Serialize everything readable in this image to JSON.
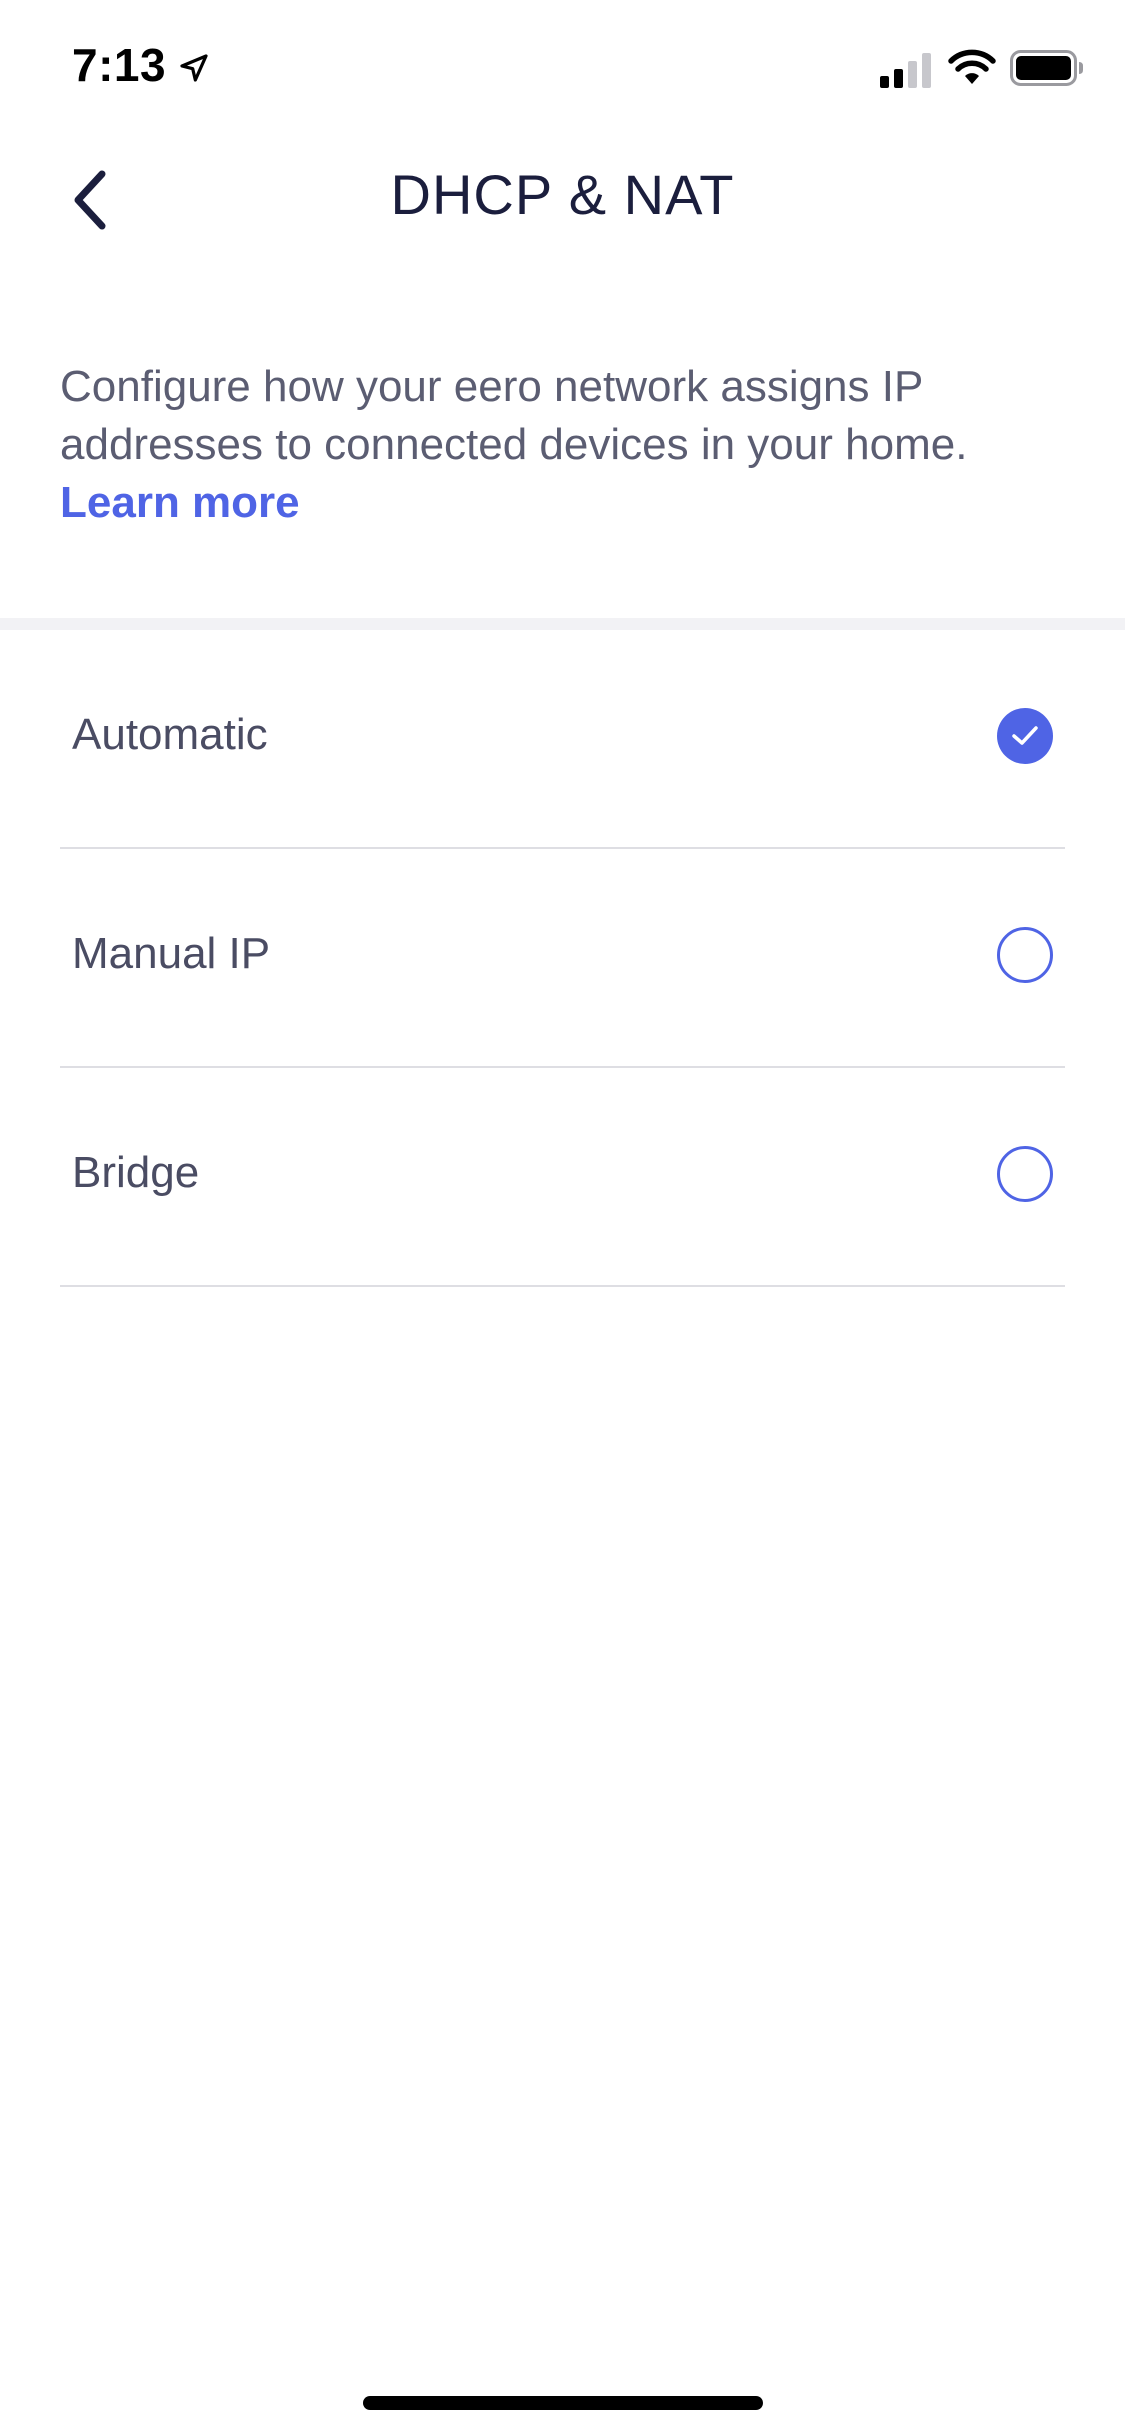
{
  "status_bar": {
    "time": "7:13",
    "icons": [
      "location-arrow-icon",
      "signal-icon",
      "wifi-icon",
      "battery-icon"
    ]
  },
  "header": {
    "back_icon": "chevron-left-icon",
    "title": "DHCP & NAT"
  },
  "description": {
    "text": "Configure how your eero network assigns IP addresses to connected devices in your home.",
    "link_label": "Learn more"
  },
  "options": [
    {
      "label": "Automatic",
      "selected": true
    },
    {
      "label": "Manual IP",
      "selected": false
    },
    {
      "label": "Bridge",
      "selected": false
    }
  ],
  "colors": {
    "accent": "#4f64e5",
    "title": "#1b1e3d",
    "body_text": "#5b5d72",
    "divider": "#dedee3"
  }
}
